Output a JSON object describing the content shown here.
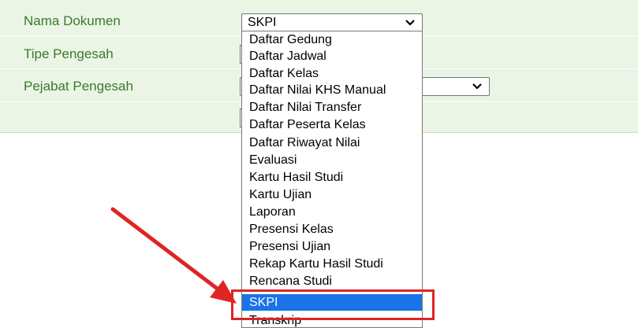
{
  "form": {
    "nama_dokumen_label": "Nama Dokumen",
    "tipe_pengesah_label": "Tipe Pengesah",
    "pejabat_pengesah_label": "Pejabat Pengesah",
    "nama_dokumen_value": "SKPI"
  },
  "dropdown": {
    "options": [
      "Daftar Gedung",
      "Daftar Jadwal",
      "Daftar Kelas",
      "Daftar Nilai KHS Manual",
      "Daftar Nilai Transfer",
      "Daftar Peserta Kelas",
      "Daftar Riwayat Nilai",
      "Evaluasi",
      "Kartu Hasil Studi",
      "Kartu Ujian",
      "Laporan",
      "Presensi Kelas",
      "Presensi Ujian",
      "Rekap Kartu Hasil Studi",
      "Rencana Studi",
      "SKPI",
      "Transkrip"
    ],
    "selected": "SKPI"
  },
  "colors": {
    "panel_bg": "#eaf5e5",
    "label_text": "#3a7a2a",
    "selected_bg": "#1a73e8",
    "annotation_red": "#e02424"
  },
  "icons": {
    "select_chevron": "chevron-down-icon",
    "annotation_arrow": "red-arrow-icon"
  }
}
